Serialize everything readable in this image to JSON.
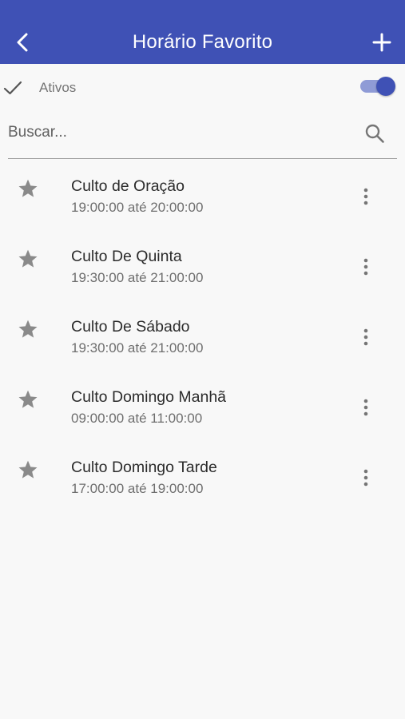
{
  "header": {
    "title": "Horário Favorito",
    "back_icon": "chevron-left-icon",
    "add_icon": "plus-icon"
  },
  "filter": {
    "label": "Ativos",
    "toggle_on": true
  },
  "search": {
    "placeholder": "Buscar..."
  },
  "items": [
    {
      "name": "Culto de Oração",
      "time": "19:00:00 até 20:00:00"
    },
    {
      "name": "Culto De Quinta",
      "time": "19:30:00 até 21:00:00"
    },
    {
      "name": "Culto De Sábado",
      "time": "19:30:00 até 21:00:00"
    },
    {
      "name": "Culto Domingo Manhã",
      "time": "09:00:00 até 11:00:00"
    },
    {
      "name": "Culto Domingo Tarde",
      "time": "17:00:00 até 19:00:00"
    }
  ],
  "colors": {
    "primary": "#3f51b5",
    "toggle_track": "#8f9bd6",
    "background": "#f8f8f8",
    "icon_gray": "#8a8a8a"
  }
}
